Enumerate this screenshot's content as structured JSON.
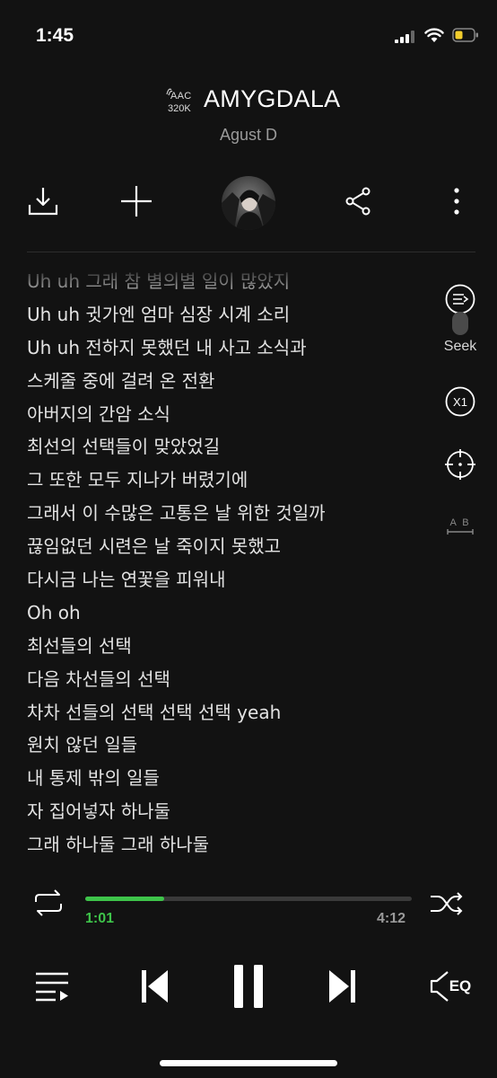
{
  "status_bar": {
    "time": "1:45"
  },
  "header": {
    "codec": "AAC",
    "bitrate": "320K",
    "title": "AMYGDALA",
    "artist": "Agust D"
  },
  "actions": {
    "download_icon": "download-icon",
    "add_icon": "plus-icon",
    "share_icon": "share-icon",
    "more_icon": "more-vertical-icon"
  },
  "lyrics": [
    "Uh uh 그래 참 별의별 일이 많았지",
    "Uh uh 귓가엔 엄마 심장 시계 소리",
    "Uh uh 전하지 못했던 내 사고 소식과",
    "스케줄 중에 걸려 온 전환",
    "아버지의 간암 소식",
    "최선의 선택들이 맞았었길",
    "그 또한 모두 지나가 버렸기에",
    "그래서 이 수많은 고통은 날 위한 것일까",
    "끊임없던 시련은 날 죽이지 못했고",
    "다시금 나는 연꽃을 피워내",
    "Oh oh",
    "최선들의 선택",
    "다음 차선들의 선택",
    "차차 선들의 선택 선택 선택 yeah",
    "원치 않던 일들",
    "내 통제 밖의 일들",
    "자 집어넣자 하나둘",
    "그래 하나둘 그래 하나둘"
  ],
  "side_tools": {
    "seek_label": "Seek",
    "speed_label": "X1",
    "ab_label": "A B"
  },
  "playback": {
    "elapsed": "1:01",
    "duration": "4:12",
    "progress_fraction": 0.2421,
    "accent_color": "#3ec44a"
  },
  "controls": {
    "eq_label": "EQ"
  }
}
